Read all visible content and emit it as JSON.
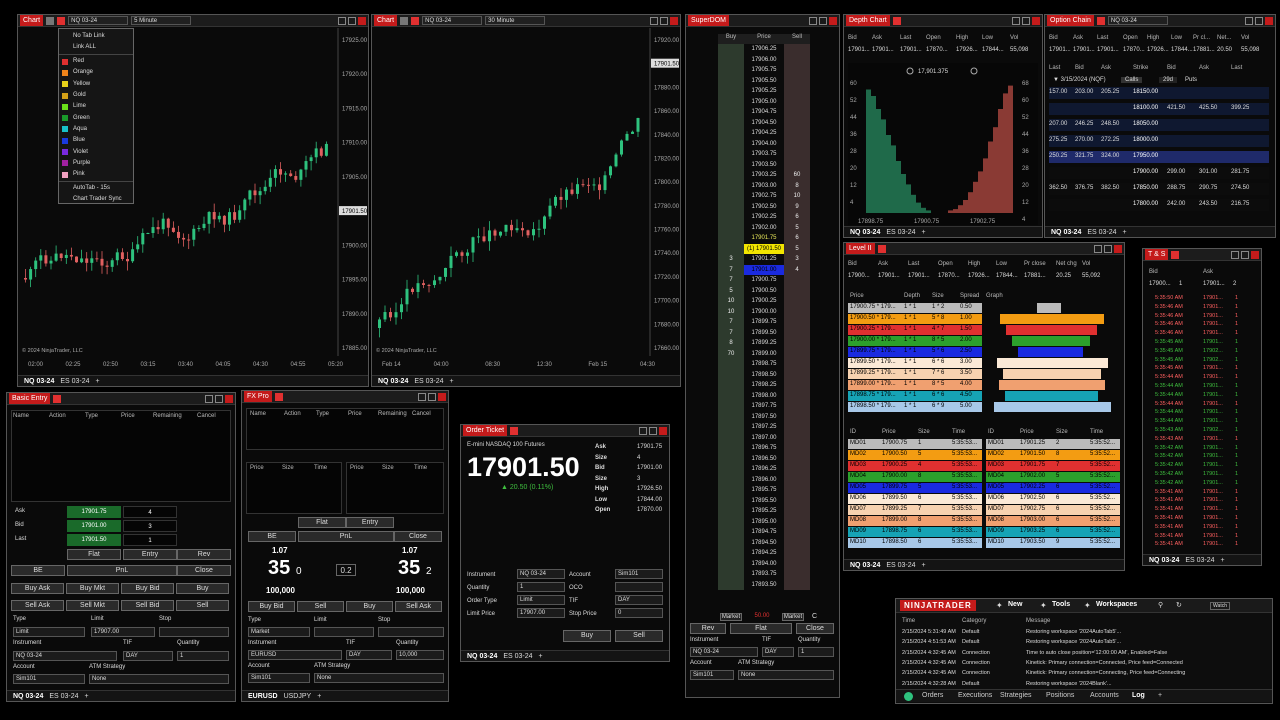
{
  "chart1": {
    "title": "Chart",
    "instrument": "NQ 03-24",
    "interval": "5 Minute",
    "copyright": "© 2024 NinjaTrader, LLC",
    "price_labels": [
      "17925.00",
      "17920.00",
      "17915.00",
      "17910.00",
      "17905.00",
      "17901.50",
      "17900.00",
      "17895.00",
      "17890.00",
      "17885.00"
    ],
    "time_labels": [
      "02:00",
      "02:25",
      "02:50",
      "03:15",
      "03:40",
      "04:05",
      "04:30",
      "04:55",
      "05:20"
    ],
    "tabs": [
      "NQ 03-24",
      "ES 03-24",
      "+"
    ]
  },
  "link_menu": {
    "items": [
      "No Tab Link",
      "Link ALL"
    ],
    "colors": [
      {
        "name": "Red",
        "color": "#e03030"
      },
      {
        "name": "Orange",
        "color": "#f0841a"
      },
      {
        "name": "Yellow",
        "color": "#e8d21a"
      },
      {
        "name": "Gold",
        "color": "#d4a017"
      },
      {
        "name": "Lime",
        "color": "#6be21a"
      },
      {
        "name": "Green",
        "color": "#1a9a2a"
      },
      {
        "name": "Aqua",
        "color": "#18c0c8"
      },
      {
        "name": "Blue",
        "color": "#1a3ae0"
      },
      {
        "name": "Violet",
        "color": "#7a2ae0"
      },
      {
        "name": "Purple",
        "color": "#a020a0"
      },
      {
        "name": "Pink",
        "color": "#f0a0c0"
      }
    ],
    "extra": [
      "AutoTab - 15s",
      "Chart Trader Sync"
    ]
  },
  "chart2": {
    "title": "Chart",
    "instrument": "NQ 03-24",
    "interval": "30 Minute",
    "copyright": "© 2024 NinjaTrader, LLC",
    "price_labels": [
      "17920.00",
      "17901.50",
      "17880.00",
      "17860.00",
      "17840.00",
      "17820.00",
      "17800.00",
      "17780.00",
      "17760.00",
      "17740.00",
      "17720.00",
      "17700.00",
      "17680.00",
      "17660.00"
    ],
    "time_labels": [
      "Feb 14",
      "04:00",
      "08:30",
      "12:30",
      "Feb 15",
      "04:30"
    ],
    "tabs": [
      "NQ 03-24",
      "ES 03-24",
      "+"
    ]
  },
  "superdom": {
    "title": "SuperDOM",
    "headers": [
      "Buy",
      "Price",
      "Sell"
    ],
    "prices": [
      "17906.25",
      "17906.00",
      "17905.75",
      "17905.50",
      "17905.25",
      "17905.00",
      "17904.75",
      "17904.50",
      "17904.25",
      "17904.00",
      "17903.75",
      "17903.50",
      "17903.25",
      "17903.00",
      "17902.75",
      "17902.50",
      "17902.25",
      "17902.00",
      "17901.75",
      "(1) 17901.50",
      "17901.25",
      "17901.00",
      "17900.75",
      "17900.50",
      "17900.25",
      "17900.00",
      "17899.75",
      "17899.50",
      "17899.25",
      "17899.00",
      "17898.75",
      "17898.50",
      "17898.25",
      "17898.00",
      "17897.75",
      "17897.50",
      "17897.25",
      "17897.00",
      "17896.75",
      "17896.50",
      "17896.25",
      "17896.00",
      "17895.75",
      "17895.50",
      "17895.25",
      "17895.00",
      "17894.75",
      "17894.50",
      "17894.25",
      "17894.00",
      "17893.75",
      "17893.50"
    ],
    "sell": [
      "",
      "",
      "",
      "",
      "",
      "",
      "",
      "",
      "",
      "",
      "",
      "",
      "60",
      "8",
      "10",
      "9",
      "6",
      "5",
      "6",
      "5",
      "3",
      "4"
    ],
    "buy": [
      "3",
      "7",
      "7",
      "5",
      "10",
      "10",
      "7",
      "7",
      "8",
      "70"
    ],
    "market_label": "Market",
    "market_value": "50.00",
    "c_label": "C",
    "buttons": [
      "Rev",
      "Flat",
      "Close"
    ],
    "instrument_label": "Instrument",
    "tif_label": "TIF",
    "quantity_label": "Quantity",
    "instrument": "NQ 03-24",
    "tif": "DAY",
    "quantity": "1",
    "account_label": "Account",
    "atm_label": "ATM Strategy",
    "account": "Sim101",
    "atm": "None",
    "tabs": [
      "NQ 03-24",
      "ES 03-24",
      "+"
    ]
  },
  "depth": {
    "title": "Depth Chart",
    "headers": [
      "Bid",
      "Ask",
      "Last",
      "Open",
      "High",
      "Low",
      "Vol"
    ],
    "values": [
      "17901...",
      "17901...",
      "17901...",
      "17870...",
      "17926...",
      "17844...",
      "55,098"
    ],
    "price_left": "17898.75",
    "price_mid": "17900.75",
    "price_right": "17902.75",
    "top_price": "17,901.375",
    "left_axis": [
      "60",
      "52",
      "44",
      "36",
      "28",
      "20",
      "12",
      "4"
    ],
    "right_axis": [
      "68",
      "60",
      "52",
      "44",
      "36",
      "28",
      "20",
      "12",
      "4"
    ],
    "tabs": [
      "NQ 03-24",
      "ES 03-24",
      "+"
    ]
  },
  "option": {
    "title": "Option Chain",
    "instrument": "NQ 03-24",
    "headers": [
      "Bid",
      "Ask",
      "Last",
      "Open",
      "High",
      "Low",
      "Pr cl...",
      "Net...",
      "Vol"
    ],
    "values": [
      "17901...",
      "17901...",
      "17901...",
      "17870...",
      "17926...",
      "17844...",
      "17881...",
      "20.50",
      "55,098"
    ],
    "chain_headers": [
      "Last",
      "Bid",
      "Ask",
      "Strike",
      "Bid",
      "Ask",
      "Last"
    ],
    "expiry": "3/15/2024 (NQF)",
    "calls_label": "Calls",
    "days": "29d",
    "puts_label": "Puts",
    "rows": [
      [
        "157.00",
        "203.00",
        "205.25",
        "18150.00",
        "",
        "",
        ""
      ],
      [
        "",
        "",
        "",
        "18100.00",
        "421.50",
        "425.50",
        "399.25"
      ],
      [
        "207.00",
        "246.25",
        "248.50",
        "18050.00",
        "",
        "",
        ""
      ],
      [
        "275.25",
        "270.00",
        "272.25",
        "18000.00",
        "",
        "",
        ""
      ],
      [
        "250.25",
        "321.75",
        "324.00",
        "17950.00",
        "",
        "",
        ""
      ],
      [
        "",
        "",
        "",
        "17900.00",
        "299.00",
        "301.00",
        "281.75"
      ],
      [
        "362.50",
        "376.75",
        "382.50",
        "17850.00",
        "288.75",
        "290.75",
        "274.50"
      ],
      [
        "",
        "",
        "",
        "17800.00",
        "242.00",
        "243.50",
        "216.75"
      ]
    ],
    "tabs": [
      "NQ 03-24",
      "ES 03-24",
      "+"
    ]
  },
  "level2": {
    "title": "Level II",
    "headers": [
      "Bid",
      "Ask",
      "Last",
      "Open",
      "High",
      "Low",
      "Pr close",
      "Net chg",
      "Vol"
    ],
    "values": [
      "17900...",
      "17901...",
      "17901...",
      "17870...",
      "17926...",
      "17844...",
      "17881...",
      "20.25",
      "55,092"
    ],
    "book_headers": [
      "Price",
      "Depth",
      "Size",
      "Spread",
      "Graph"
    ],
    "book": [
      [
        "17900.75 * 179...",
        "1 * 1",
        "1 * 2",
        "0.50",
        "#bbbbbb"
      ],
      [
        "17900.50 * 179...",
        "1 * 1",
        "5 * 8",
        "1.00",
        "#f39c12"
      ],
      [
        "17900.25 * 179...",
        "1 * 1",
        "4 * 7",
        "1.50",
        "#e03030"
      ],
      [
        "17900.00 * 179...",
        "1 * 1",
        "8 * 5",
        "2.00",
        "#2ca02c"
      ],
      [
        "17899.75 * 179...",
        "1 * 1",
        "5 * 6",
        "2.50",
        "#1a2ae0"
      ],
      [
        "17899.50 * 179...",
        "1 * 1",
        "6 * 6",
        "3.00",
        "#fbe9d6"
      ],
      [
        "17899.25 * 179...",
        "1 * 1",
        "7 * 6",
        "3.50",
        "#f7d2b0"
      ],
      [
        "17899.00 * 179...",
        "1 * 1",
        "8 * 5",
        "4.00",
        "#f0a070"
      ],
      [
        "17898.75 * 179...",
        "1 * 1",
        "6 * 6",
        "4.50",
        "#16a3b5"
      ],
      [
        "17898.50 * 179...",
        "1 * 1",
        "6 * 9",
        "5.00",
        "#a8c8e8"
      ]
    ],
    "md_headers": [
      "ID",
      "Price",
      "Size",
      "Time"
    ],
    "bids": [
      [
        "MD01",
        "17900.75",
        "1",
        "5:35:53..."
      ],
      [
        "MD02",
        "17900.50",
        "5",
        "5:35:53..."
      ],
      [
        "MD03",
        "17900.25",
        "4",
        "5:35:53..."
      ],
      [
        "MD04",
        "17900.00",
        "8",
        "5:35:53..."
      ],
      [
        "MD05",
        "17899.75",
        "5",
        "5:35:53..."
      ],
      [
        "MD06",
        "17899.50",
        "6",
        "5:35:53..."
      ],
      [
        "MD07",
        "17899.25",
        "7",
        "5:35:53..."
      ],
      [
        "MD08",
        "17899.00",
        "8",
        "5:35:53..."
      ],
      [
        "MD09",
        "17898.75",
        "6",
        "5:35:53..."
      ],
      [
        "MD10",
        "17898.50",
        "6",
        "5:35:53..."
      ]
    ],
    "asks": [
      [
        "MD01",
        "17901.25",
        "2",
        "5:35:52..."
      ],
      [
        "MD02",
        "17901.50",
        "8",
        "5:35:52..."
      ],
      [
        "MD03",
        "17901.75",
        "7",
        "5:35:52..."
      ],
      [
        "MD04",
        "17902.00",
        "5",
        "5:35:52..."
      ],
      [
        "MD05",
        "17902.25",
        "6",
        "5:35:52..."
      ],
      [
        "MD06",
        "17902.50",
        "6",
        "5:35:52..."
      ],
      [
        "MD07",
        "17902.75",
        "6",
        "5:35:52..."
      ],
      [
        "MD08",
        "17903.00",
        "6",
        "5:35:52..."
      ],
      [
        "MD09",
        "17903.25",
        "6",
        "5:35:52..."
      ],
      [
        "MD10",
        "17903.50",
        "9",
        "5:35:52..."
      ]
    ],
    "tabs": [
      "NQ 03-24",
      "ES 03-24",
      "+"
    ]
  },
  "ts": {
    "title": "T & S",
    "headers": [
      "Bid",
      "Ask"
    ],
    "first": [
      "17900...",
      "1",
      "17901...",
      "2"
    ],
    "rows": [
      [
        "5:35:50 AM",
        "17901...",
        "1",
        "#ff6060"
      ],
      [
        "5:35:46 AM",
        "17901...",
        "1",
        "#ff6060"
      ],
      [
        "5:35:46 AM",
        "17901...",
        "1",
        "#ff6060"
      ],
      [
        "5:35:46 AM",
        "17901...",
        "1",
        "#ff6060"
      ],
      [
        "5:35:46 AM",
        "17901...",
        "1",
        "#ff6060"
      ],
      [
        "5:35:45 AM",
        "17901...",
        "1",
        "#3fbf3f"
      ],
      [
        "5:35:45 AM",
        "17902...",
        "1",
        "#3fbf3f"
      ],
      [
        "5:35:45 AM",
        "17902...",
        "1",
        "#3fbf3f"
      ],
      [
        "5:35:45 AM",
        "17901...",
        "1",
        "#ff6060"
      ],
      [
        "5:35:44 AM",
        "17901...",
        "1",
        "#ff6060"
      ],
      [
        "5:35:44 AM",
        "17901...",
        "1",
        "#3fbf3f"
      ],
      [
        "5:35:44 AM",
        "17901...",
        "1",
        "#3fbf3f"
      ],
      [
        "5:35:44 AM",
        "17901...",
        "1",
        "#ff6060"
      ],
      [
        "5:35:44 AM",
        "17901...",
        "1",
        "#3fbf3f"
      ],
      [
        "5:35:44 AM",
        "17901...",
        "1",
        "#3fbf3f"
      ],
      [
        "5:35:43 AM",
        "17902...",
        "1",
        "#3fbf3f"
      ],
      [
        "5:35:43 AM",
        "17901...",
        "1",
        "#ff6060"
      ],
      [
        "5:35:42 AM",
        "17901...",
        "1",
        "#3fbf3f"
      ],
      [
        "5:35:42 AM",
        "17901...",
        "1",
        "#3fbf3f"
      ],
      [
        "5:35:42 AM",
        "17901...",
        "1",
        "#3fbf3f"
      ],
      [
        "5:35:42 AM",
        "17901...",
        "1",
        "#3fbf3f"
      ],
      [
        "5:35:42 AM",
        "17901...",
        "1",
        "#3fbf3f"
      ],
      [
        "5:35:41 AM",
        "17901...",
        "1",
        "#ff6060"
      ],
      [
        "5:35:41 AM",
        "17901...",
        "1",
        "#ff6060"
      ],
      [
        "5:35:41 AM",
        "17901...",
        "1",
        "#ff6060"
      ],
      [
        "5:35:41 AM",
        "17901...",
        "1",
        "#ff6060"
      ],
      [
        "5:35:41 AM",
        "17901...",
        "1",
        "#ff6060"
      ],
      [
        "5:35:41 AM",
        "17901...",
        "1",
        "#ff6060"
      ],
      [
        "5:35:41 AM",
        "17901...",
        "1",
        "#ff6060"
      ]
    ],
    "tabs": [
      "NQ 03-24",
      "ES 03-24",
      "+"
    ]
  },
  "basic": {
    "title": "Basic Entry",
    "headers": [
      "Name",
      "Action",
      "Type",
      "Price",
      "Remaining",
      "Cancel"
    ],
    "ask_label": "Ask",
    "ask": "17901.75",
    "ask_size": "4",
    "bid_label": "Bid",
    "bid": "17901.00",
    "bid_size": "3",
    "last_label": "Last",
    "last": "17901.50",
    "last_size": "1",
    "flat": "Flat",
    "entry": "Entry",
    "rev": "Rev",
    "be": "BE",
    "pnl": "PnL",
    "close": "Close",
    "buy_ask": "Buy Ask",
    "buy_mkt": "Buy Mkt",
    "buy_bid": "Buy Bid",
    "buy": "Buy",
    "sell_ask": "Sell Ask",
    "sell_mkt": "Sell Mkt",
    "sell_bid": "Sell Bid",
    "sell": "Sell",
    "type_label": "Type",
    "limit_label": "Limit",
    "stop_label": "Stop",
    "type": "Limit",
    "limit": "17907.00",
    "instrument_label": "Instrument",
    "tif_label": "TIF",
    "quantity_label": "Quantity",
    "instrument": "NQ 03-24",
    "tif": "DAY",
    "quantity": "1",
    "account_label": "Account",
    "atm_label": "ATM Strategy",
    "account": "Sim101",
    "atm": "None",
    "tabs": [
      "NQ 03-24",
      "ES 03-24",
      "+"
    ]
  },
  "fx": {
    "title": "FX Pro",
    "headers": [
      "Name",
      "Action",
      "Type",
      "Price",
      "Remaining",
      "Cancel"
    ],
    "sub_headers": [
      "Price",
      "Size",
      "Time"
    ],
    "flat": "Flat",
    "entry": "Entry",
    "be": "BE",
    "pnl": "PnL",
    "close": "Close",
    "big_left": "1.07",
    "pip_left": "35",
    "frac_left": "0",
    "spread": "0.2",
    "big_right": "1.07",
    "pip_right": "35",
    "frac_right": "2",
    "size_left": "100,000",
    "size_right": "100,000",
    "buy_bid": "Buy Bid",
    "sell": "Sell",
    "buy": "Buy",
    "sell_ask": "Sell Ask",
    "type_label": "Type",
    "limit_label": "Limit",
    "stop_label": "Stop",
    "type": "Market",
    "instrument_label": "Instrument",
    "tif_label": "TIF",
    "quantity_label": "Quantity",
    "instrument": "EURUSD",
    "tif": "DAY",
    "quantity": "10,000",
    "account_label": "Account",
    "atm_label": "ATM Strategy",
    "account": "Sim101",
    "atm": "None",
    "tabs": [
      "EURUSD",
      "USDJPY",
      "+"
    ]
  },
  "ticket": {
    "title": "Order Ticket",
    "name": "E-mini NASDAQ 100 Futures",
    "price": "17901.50",
    "change": "▲ 20.50 (0.11%)",
    "stats": [
      [
        "Ask",
        "17901.75"
      ],
      [
        "Size",
        "4"
      ],
      [
        "Bid",
        "17901.00"
      ],
      [
        "Size",
        "3"
      ],
      [
        "High",
        "17926.50"
      ],
      [
        "Low",
        "17844.00"
      ],
      [
        "Open",
        "17870.00"
      ]
    ],
    "instrument_label": "Instrument",
    "instrument": "NQ 03-24",
    "account_label": "Account",
    "account": "Sim101",
    "quantity_label": "Quantity",
    "quantity": "1",
    "oco_label": "OCO",
    "order_type_label": "Order Type",
    "order_type": "Limit",
    "tif_label": "TIF",
    "tif": "DAY",
    "limit_label": "Limit Price",
    "limit": "17907.00",
    "stop_label": "Stop Price",
    "stop": "0",
    "buy": "Buy",
    "sell": "Sell",
    "tabs": [
      "NQ 03-24",
      "ES 03-24",
      "+"
    ]
  },
  "control": {
    "logo": "NINJATRADER",
    "menu": [
      "New",
      "Tools",
      "Workspaces"
    ],
    "watch": "Watch",
    "headers": [
      "Time",
      "Category",
      "Message"
    ],
    "rows": [
      [
        "2/15/2024 5:31:49 AM",
        "Default",
        "Restoring workspace '2024AutoTab5'..."
      ],
      [
        "2/15/2024 4:51:53 AM",
        "Default",
        "Restoring workspace '2024AutoTab5'..."
      ],
      [
        "2/15/2024 4:32:45 AM",
        "Connection",
        "Time to auto close position='12:00:00 AM', Enabled=False"
      ],
      [
        "2/15/2024 4:32:45 AM",
        "Connection",
        "Kinetick: Primary connection=Connected, Price feed=Connected"
      ],
      [
        "2/15/2024 4:32:45 AM",
        "Connection",
        "Kinetick: Primary connection=Connecting, Price feed=Connecting"
      ],
      [
        "2/15/2024 4:32:28 AM",
        "Default",
        "Restoring workspace '2024Blank'..."
      ]
    ],
    "tabs": [
      "Orders",
      "Executions",
      "Strategies",
      "Positions",
      "Accounts",
      "Log",
      "+"
    ]
  }
}
